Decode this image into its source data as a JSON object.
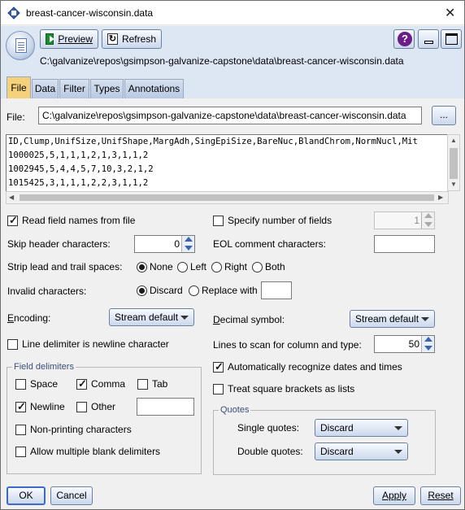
{
  "window": {
    "title": "breast-cancer-wisconsin.data",
    "close_glyph": "✕"
  },
  "toolbar": {
    "preview_label": "Preview",
    "refresh_label": "Refresh",
    "help_glyph": "?",
    "path": "C:\\galvanize\\repos\\gsimpson-galvanize-capstone\\data\\breast-cancer-wisconsin.data"
  },
  "tabs": [
    {
      "label": "File",
      "active": true
    },
    {
      "label": "Data",
      "active": false
    },
    {
      "label": "Filter",
      "active": false
    },
    {
      "label": "Types",
      "active": false
    },
    {
      "label": "Annotations",
      "active": false
    }
  ],
  "file": {
    "label": "File:",
    "value": "C:\\galvanize\\repos\\gsimpson-galvanize-capstone\\data\\breast-cancer-wisconsin.data",
    "browse_label": "..."
  },
  "preview_lines": [
    "ID,Clump,UnifSize,UnifShape,MargAdh,SingEpiSize,BareNuc,BlandChrom,NormNucl,Mit",
    "1000025,5,1,1,1,2,1,3,1,1,2",
    "1002945,5,4,4,5,7,10,3,2,1,2",
    "1015425,3,1,1,1,2,2,3,1,1,2"
  ],
  "options": {
    "read_field_names": {
      "label": "Read field names from file",
      "checked": true
    },
    "specify_num_fields": {
      "label": "Specify number of fields",
      "checked": false,
      "value": "1"
    },
    "skip_header": {
      "label": "Skip header characters:",
      "value": "0"
    },
    "eol_comment": {
      "label": "EOL comment characters:",
      "value": ""
    },
    "strip": {
      "label": "Strip lead and trail spaces:",
      "options": [
        {
          "label": "None",
          "selected": true
        },
        {
          "label": "Left",
          "selected": false
        },
        {
          "label": "Right",
          "selected": false
        },
        {
          "label": "Both",
          "selected": false
        }
      ]
    },
    "invalid": {
      "label": "Invalid characters:",
      "discard_label": "Discard",
      "replace_label": "Replace with",
      "discard_selected": true,
      "replace_value": ""
    },
    "encoding": {
      "label_first": "E",
      "label_rest": "ncoding:",
      "value": "Stream default"
    },
    "decimal": {
      "label_first": "D",
      "label_rest": "ecimal symbol:",
      "value": "Stream default"
    },
    "line_delim": {
      "label": "Line delimiter is newline character",
      "checked": false
    },
    "lines_scan": {
      "label": "Lines to scan for column and type:",
      "value": "50"
    },
    "auto_dates": {
      "label": "Automatically recognize dates and times",
      "checked": true
    },
    "square_brackets": {
      "label": "Treat square brackets as lists",
      "checked": false
    }
  },
  "field_delimiters": {
    "title": "Field delimiters",
    "space": {
      "label": "Space",
      "checked": false
    },
    "comma": {
      "label": "Comma",
      "checked": true
    },
    "tab": {
      "label": "Tab",
      "checked": false
    },
    "newline": {
      "label": "Newline",
      "checked": true
    },
    "other": {
      "label": "Other",
      "checked": false,
      "value": ""
    },
    "non_printing": {
      "label": "Non-printing characters",
      "checked": false
    },
    "multiple_blank": {
      "label": "Allow multiple blank delimiters",
      "checked": false
    }
  },
  "quotes": {
    "title": "Quotes",
    "single": {
      "label": "Single quotes:",
      "value": "Discard"
    },
    "double": {
      "label": "Double quotes:",
      "value": "Discard"
    }
  },
  "footer": {
    "ok_label": "OK",
    "cancel_label": "Cancel",
    "apply_label": "Apply",
    "reset_label": "Reset"
  }
}
